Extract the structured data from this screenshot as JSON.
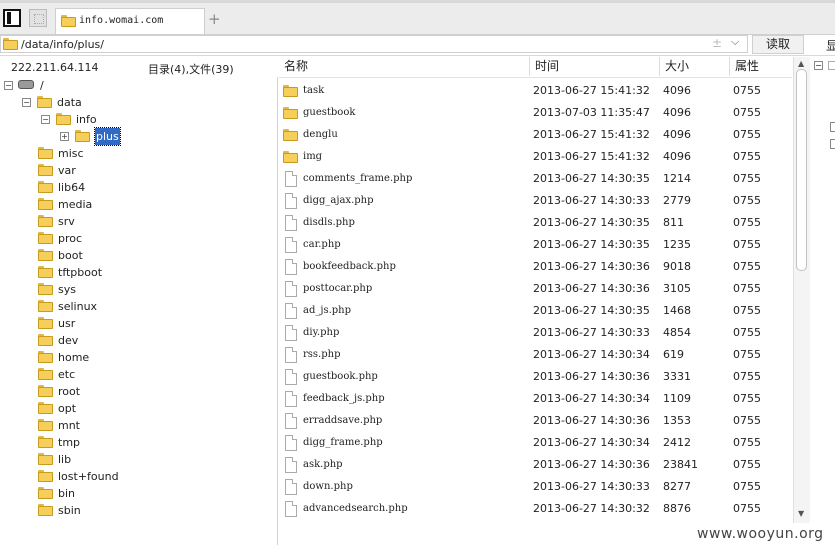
{
  "browser": {
    "tab_title": "info.womai.com",
    "new_tab_symbol": "+"
  },
  "address_bar": {
    "path": "/data/info/plus/",
    "read_button": "读取",
    "overflow_text": "显"
  },
  "info_bar": {
    "ip": "222.211.64.114",
    "counts": "目录(4),文件(39)"
  },
  "tree": {
    "root_label": "/",
    "nodes": [
      {
        "label": "data"
      },
      {
        "label": "info"
      },
      {
        "label": "plus"
      },
      {
        "label": "misc"
      },
      {
        "label": "var"
      },
      {
        "label": "lib64"
      },
      {
        "label": "media"
      },
      {
        "label": "srv"
      },
      {
        "label": "proc"
      },
      {
        "label": "boot"
      },
      {
        "label": "tftpboot"
      },
      {
        "label": "sys"
      },
      {
        "label": "selinux"
      },
      {
        "label": "usr"
      },
      {
        "label": "dev"
      },
      {
        "label": "home"
      },
      {
        "label": "etc"
      },
      {
        "label": "root"
      },
      {
        "label": "opt"
      },
      {
        "label": "mnt"
      },
      {
        "label": "tmp"
      },
      {
        "label": "lib"
      },
      {
        "label": "lost+found"
      },
      {
        "label": "bin"
      },
      {
        "label": "sbin"
      }
    ]
  },
  "columns": {
    "name": "名称",
    "time": "时间",
    "size": "大小",
    "attr": "属性"
  },
  "files": [
    {
      "name": "task",
      "time": "2013-06-27 15:41:32",
      "size": "4096",
      "attr": "0755",
      "kind": "folder"
    },
    {
      "name": "guestbook",
      "time": "2013-07-03 11:35:47",
      "size": "4096",
      "attr": "0755",
      "kind": "folder"
    },
    {
      "name": "denglu",
      "time": "2013-06-27 15:41:32",
      "size": "4096",
      "attr": "0755",
      "kind": "folder"
    },
    {
      "name": "img",
      "time": "2013-06-27 15:41:32",
      "size": "4096",
      "attr": "0755",
      "kind": "folder"
    },
    {
      "name": "comments_frame.php",
      "time": "2013-06-27 14:30:35",
      "size": "1214",
      "attr": "0755",
      "kind": "file"
    },
    {
      "name": "digg_ajax.php",
      "time": "2013-06-27 14:30:33",
      "size": "2779",
      "attr": "0755",
      "kind": "file"
    },
    {
      "name": "disdls.php",
      "time": "2013-06-27 14:30:35",
      "size": "811",
      "attr": "0755",
      "kind": "file"
    },
    {
      "name": "car.php",
      "time": "2013-06-27 14:30:35",
      "size": "1235",
      "attr": "0755",
      "kind": "file"
    },
    {
      "name": "bookfeedback.php",
      "time": "2013-06-27 14:30:36",
      "size": "9018",
      "attr": "0755",
      "kind": "file"
    },
    {
      "name": "posttocar.php",
      "time": "2013-06-27 14:30:36",
      "size": "3105",
      "attr": "0755",
      "kind": "file"
    },
    {
      "name": "ad_js.php",
      "time": "2013-06-27 14:30:35",
      "size": "1468",
      "attr": "0755",
      "kind": "file"
    },
    {
      "name": "diy.php",
      "time": "2013-06-27 14:30:33",
      "size": "4854",
      "attr": "0755",
      "kind": "file"
    },
    {
      "name": "rss.php",
      "time": "2013-06-27 14:30:34",
      "size": "619",
      "attr": "0755",
      "kind": "file"
    },
    {
      "name": "guestbook.php",
      "time": "2013-06-27 14:30:36",
      "size": "3331",
      "attr": "0755",
      "kind": "file"
    },
    {
      "name": "feedback_js.php",
      "time": "2013-06-27 14:30:34",
      "size": "1109",
      "attr": "0755",
      "kind": "file"
    },
    {
      "name": "erraddsave.php",
      "time": "2013-06-27 14:30:36",
      "size": "1353",
      "attr": "0755",
      "kind": "file"
    },
    {
      "name": "digg_frame.php",
      "time": "2013-06-27 14:30:34",
      "size": "2412",
      "attr": "0755",
      "kind": "file"
    },
    {
      "name": "ask.php",
      "time": "2013-06-27 14:30:36",
      "size": "23841",
      "attr": "0755",
      "kind": "file"
    },
    {
      "name": "down.php",
      "time": "2013-06-27 14:30:33",
      "size": "8277",
      "attr": "0755",
      "kind": "file"
    },
    {
      "name": "advancedsearch.php",
      "time": "2013-06-27 14:30:32",
      "size": "8876",
      "attr": "0755",
      "kind": "file"
    }
  ],
  "watermark": "www.wooyun.org",
  "colors": {
    "folder": "#f6cf5b",
    "selection": "#316ac5"
  }
}
